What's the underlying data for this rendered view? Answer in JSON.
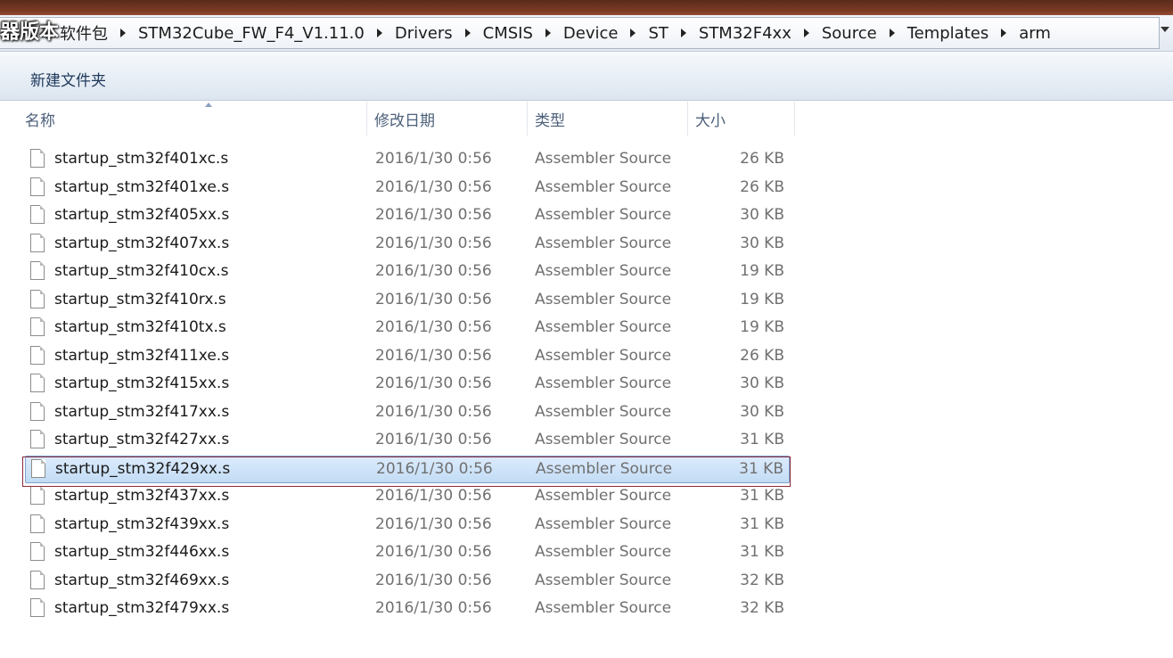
{
  "overlay_text": "器版本",
  "breadcrumb": {
    "first": "软件包",
    "items": [
      "STM32Cube_FW_F4_V1.11.0",
      "Drivers",
      "CMSIS",
      "Device",
      "ST",
      "STM32F4xx",
      "Source",
      "Templates",
      "arm"
    ]
  },
  "toolbar": {
    "new_folder_label": "新建文件夹"
  },
  "columns": {
    "name": "名称",
    "date": "修改日期",
    "type": "类型",
    "size": "大小"
  },
  "files": [
    {
      "name": "startup_stm32f401xc.s",
      "date": "2016/1/30 0:56",
      "type": "Assembler Source",
      "size": "26 KB"
    },
    {
      "name": "startup_stm32f401xe.s",
      "date": "2016/1/30 0:56",
      "type": "Assembler Source",
      "size": "26 KB"
    },
    {
      "name": "startup_stm32f405xx.s",
      "date": "2016/1/30 0:56",
      "type": "Assembler Source",
      "size": "30 KB"
    },
    {
      "name": "startup_stm32f407xx.s",
      "date": "2016/1/30 0:56",
      "type": "Assembler Source",
      "size": "30 KB"
    },
    {
      "name": "startup_stm32f410cx.s",
      "date": "2016/1/30 0:56",
      "type": "Assembler Source",
      "size": "19 KB"
    },
    {
      "name": "startup_stm32f410rx.s",
      "date": "2016/1/30 0:56",
      "type": "Assembler Source",
      "size": "19 KB"
    },
    {
      "name": "startup_stm32f410tx.s",
      "date": "2016/1/30 0:56",
      "type": "Assembler Source",
      "size": "19 KB"
    },
    {
      "name": "startup_stm32f411xe.s",
      "date": "2016/1/30 0:56",
      "type": "Assembler Source",
      "size": "26 KB"
    },
    {
      "name": "startup_stm32f415xx.s",
      "date": "2016/1/30 0:56",
      "type": "Assembler Source",
      "size": "30 KB"
    },
    {
      "name": "startup_stm32f417xx.s",
      "date": "2016/1/30 0:56",
      "type": "Assembler Source",
      "size": "30 KB"
    },
    {
      "name": "startup_stm32f427xx.s",
      "date": "2016/1/30 0:56",
      "type": "Assembler Source",
      "size": "31 KB"
    },
    {
      "name": "startup_stm32f429xx.s",
      "date": "2016/1/30 0:56",
      "type": "Assembler Source",
      "size": "31 KB",
      "selected": true
    },
    {
      "name": "startup_stm32f437xx.s",
      "date": "2016/1/30 0:56",
      "type": "Assembler Source",
      "size": "31 KB"
    },
    {
      "name": "startup_stm32f439xx.s",
      "date": "2016/1/30 0:56",
      "type": "Assembler Source",
      "size": "31 KB"
    },
    {
      "name": "startup_stm32f446xx.s",
      "date": "2016/1/30 0:56",
      "type": "Assembler Source",
      "size": "31 KB"
    },
    {
      "name": "startup_stm32f469xx.s",
      "date": "2016/1/30 0:56",
      "type": "Assembler Source",
      "size": "32 KB"
    },
    {
      "name": "startup_stm32f479xx.s",
      "date": "2016/1/30 0:56",
      "type": "Assembler Source",
      "size": "32 KB"
    }
  ],
  "colors": {
    "selection": "#c2dcf5",
    "highlight_border": "#8b2a3a",
    "title_strip": "#7a3a24"
  }
}
